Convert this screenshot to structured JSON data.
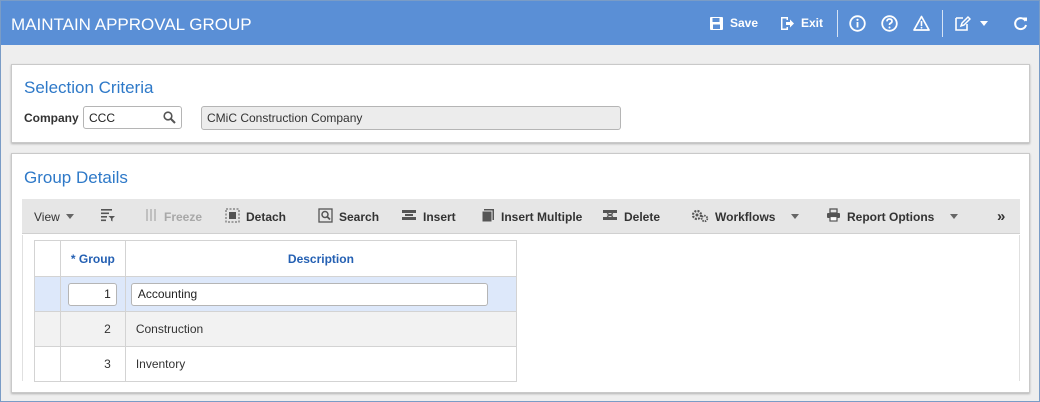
{
  "header": {
    "title": "MAINTAIN APPROVAL GROUP",
    "save_label": "Save",
    "exit_label": "Exit",
    "bg_color": "#5a8fd6"
  },
  "selection": {
    "title": "Selection Criteria",
    "company_label": "Company",
    "company_value": "CCC",
    "company_name": "CMiC Construction Company"
  },
  "group_details": {
    "title": "Group Details",
    "toolbar": {
      "view": "View",
      "freeze": "Freeze",
      "detach": "Detach",
      "search": "Search",
      "insert": "Insert",
      "insert_multiple": "Insert Multiple",
      "delete": "Delete",
      "workflows": "Workflows",
      "report_options": "Report Options",
      "more": "»"
    },
    "columns": [
      "* Group",
      "Description"
    ],
    "rows": [
      {
        "group": "1",
        "description": "Accounting"
      },
      {
        "group": "2",
        "description": "Construction"
      },
      {
        "group": "3",
        "description": "Inventory"
      }
    ]
  },
  "colors": {
    "accent": "#2e79c8",
    "header_text_grid": "#2460b3",
    "active_row": "#dde8fa"
  }
}
